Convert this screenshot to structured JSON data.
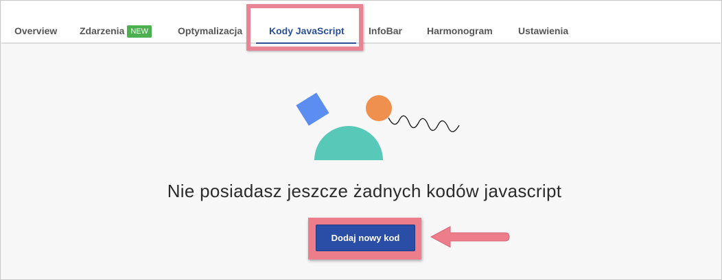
{
  "tabs": [
    {
      "label": "Overview"
    },
    {
      "label": "Zdarzenia",
      "badge": "NEW"
    },
    {
      "label": "Optymalizacja"
    },
    {
      "label": "Kody JavaScript",
      "active": true
    },
    {
      "label": "InfoBar"
    },
    {
      "label": "Harmonogram"
    },
    {
      "label": "Ustawienia"
    }
  ],
  "empty_state": {
    "message": "Nie posiadasz jeszcze żadnych kodów javascript",
    "button_label": "Dodaj nowy kod"
  },
  "colors": {
    "accent": "#2a4f97",
    "button": "#2a4da6",
    "badge": "#4caf50",
    "highlight": "#e88493",
    "shape_square": "#5b8ef0",
    "shape_circle": "#f0904e",
    "shape_semicircle": "#58c8b8"
  }
}
